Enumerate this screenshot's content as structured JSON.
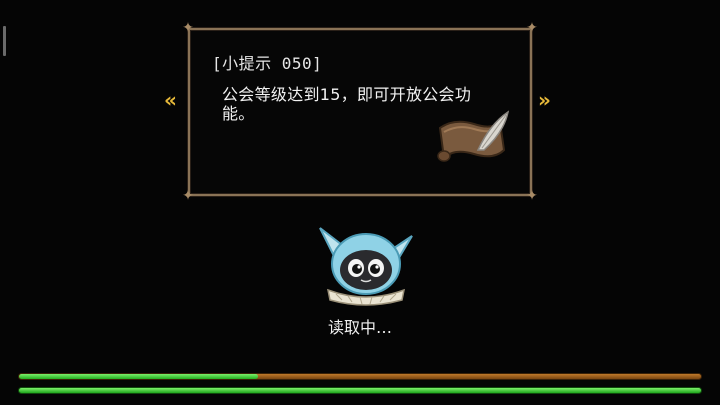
{
  "tip": {
    "title": "[小提示 050]",
    "body": "公会等级达到15，即可开放公会功能。"
  },
  "nav": {
    "prev_icon": "double-chevron-left-icon",
    "next_icon": "double-chevron-right-icon",
    "prev_glyph": "«",
    "next_glyph": "»"
  },
  "loading": {
    "text": "读取中…",
    "progress_top": 0.35,
    "progress_bottom": 1.0
  },
  "colors": {
    "frame": "#8a7356",
    "arrow": "#e7b93a",
    "bar_green": "#23b020",
    "bar_orange": "#c07a2a"
  }
}
